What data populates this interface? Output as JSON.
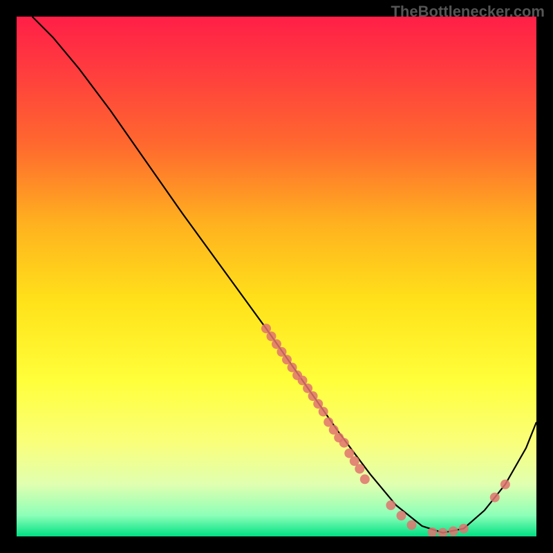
{
  "watermark": "TheBottlenecker.com",
  "chart_data": {
    "type": "line",
    "title": "",
    "xlabel": "",
    "ylabel": "",
    "xlim": [
      0,
      100
    ],
    "ylim": [
      0,
      100
    ],
    "background_gradient": {
      "stops": [
        {
          "offset": 0.0,
          "color": "#ff1f47"
        },
        {
          "offset": 0.1,
          "color": "#ff3b3f"
        },
        {
          "offset": 0.25,
          "color": "#ff6a2e"
        },
        {
          "offset": 0.4,
          "color": "#ffb21f"
        },
        {
          "offset": 0.55,
          "color": "#ffe21a"
        },
        {
          "offset": 0.7,
          "color": "#ffff3a"
        },
        {
          "offset": 0.82,
          "color": "#faff7a"
        },
        {
          "offset": 0.9,
          "color": "#e0ffb0"
        },
        {
          "offset": 0.96,
          "color": "#8cffb8"
        },
        {
          "offset": 1.0,
          "color": "#00e083"
        }
      ]
    },
    "series": [
      {
        "name": "curve",
        "x": [
          3.0,
          7.0,
          12.0,
          18.0,
          25.0,
          32.0,
          40.0,
          48.0,
          55.0,
          62.0,
          68.0,
          73.0,
          78.0,
          82.0,
          86.0,
          90.0,
          94.0,
          98.0,
          100.0
        ],
        "y": [
          100.0,
          96.0,
          90.0,
          82.0,
          72.0,
          62.0,
          51.0,
          40.0,
          30.0,
          20.0,
          12.0,
          6.0,
          2.0,
          0.7,
          1.5,
          5.0,
          10.0,
          17.0,
          22.0
        ]
      }
    ],
    "points": {
      "name": "markers",
      "color": "#e0736e",
      "x": [
        48,
        49,
        50,
        51,
        52,
        53,
        54,
        55,
        56,
        57,
        58,
        59,
        60,
        61,
        62,
        63,
        64,
        65,
        66,
        67,
        72,
        74,
        76,
        80,
        82,
        84,
        86,
        92,
        94
      ],
      "y": [
        40,
        38.5,
        37,
        35.5,
        34,
        32.5,
        31,
        30,
        28.5,
        27,
        25.5,
        24,
        22,
        20.5,
        19,
        18,
        16,
        14.5,
        13,
        11,
        6,
        4,
        2.2,
        0.8,
        0.7,
        1.0,
        1.5,
        7.5,
        10
      ]
    }
  }
}
